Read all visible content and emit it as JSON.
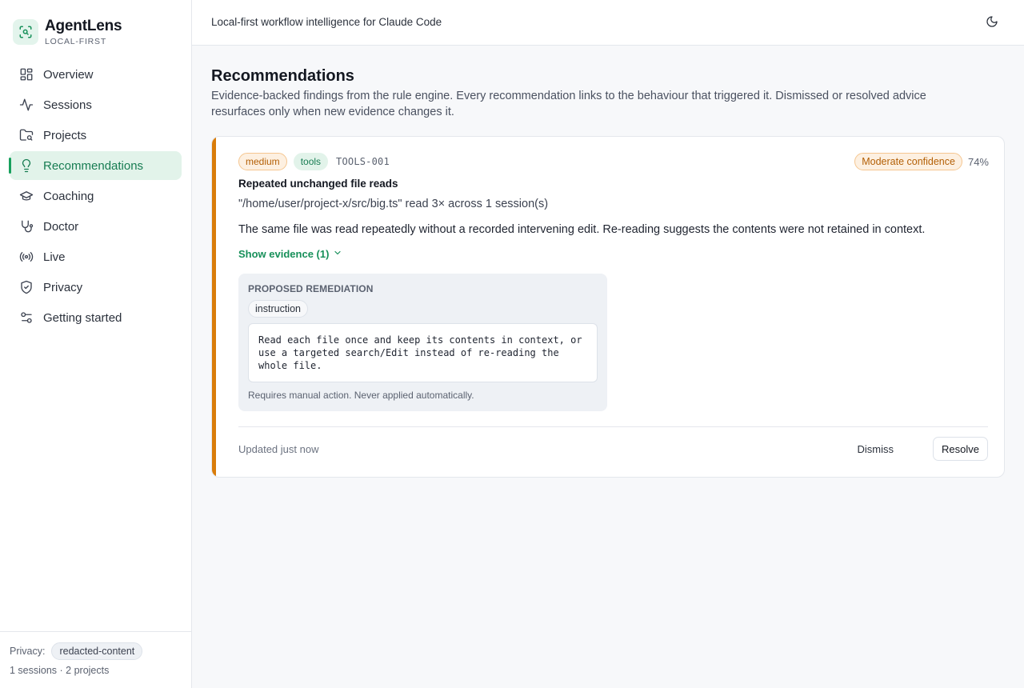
{
  "app": {
    "name": "AgentLens",
    "subtitle": "LOCAL-FIRST",
    "tagline": "Local-first workflow intelligence for Claude Code"
  },
  "sidebar": {
    "items": [
      {
        "label": "Overview",
        "icon": "grid-icon"
      },
      {
        "label": "Sessions",
        "icon": "activity-icon"
      },
      {
        "label": "Projects",
        "icon": "folder-icon"
      },
      {
        "label": "Recommendations",
        "icon": "lightbulb-icon",
        "active": true
      },
      {
        "label": "Coaching",
        "icon": "graduation-cap-icon"
      },
      {
        "label": "Doctor",
        "icon": "stethoscope-icon"
      },
      {
        "label": "Live",
        "icon": "radio-icon"
      },
      {
        "label": "Privacy",
        "icon": "shield-check-icon"
      },
      {
        "label": "Getting started",
        "icon": "sliders-icon"
      }
    ],
    "footer": {
      "privacy_label": "Privacy:",
      "privacy_mode": "redacted-content",
      "counts": "1 sessions · 2 projects"
    }
  },
  "page": {
    "title": "Recommendations",
    "description": "Evidence-backed findings from the rule engine. Every recommendation links to the behaviour that triggered it. Dismissed or resolved advice resurfaces only when new evidence changes it."
  },
  "recommendation": {
    "severity": "medium",
    "category": "tools",
    "code": "TOOLS-001",
    "confidence_label": "Moderate confidence",
    "confidence_pct": "74%",
    "title": "Repeated unchanged file reads",
    "summary": "\"/home/user/project-x/src/big.ts\" read 3× across 1 session(s)",
    "body": "The same file was read repeatedly without a recorded intervening edit. Re-reading suggests the contents were not retained in context.",
    "evidence_toggle": "Show evidence (1)",
    "remediation": {
      "heading": "PROPOSED REMEDIATION",
      "type": "instruction",
      "text": "Read each file once and keep its contents in context, or use a targeted search/Edit instead of re-reading the whole file.",
      "note": "Requires manual action. Never applied automatically."
    },
    "updated": "Updated just now",
    "dismiss_label": "Dismiss",
    "resolve_label": "Resolve"
  },
  "colors": {
    "accent": "#17a05d",
    "severity_medium": "#d97c0a"
  }
}
